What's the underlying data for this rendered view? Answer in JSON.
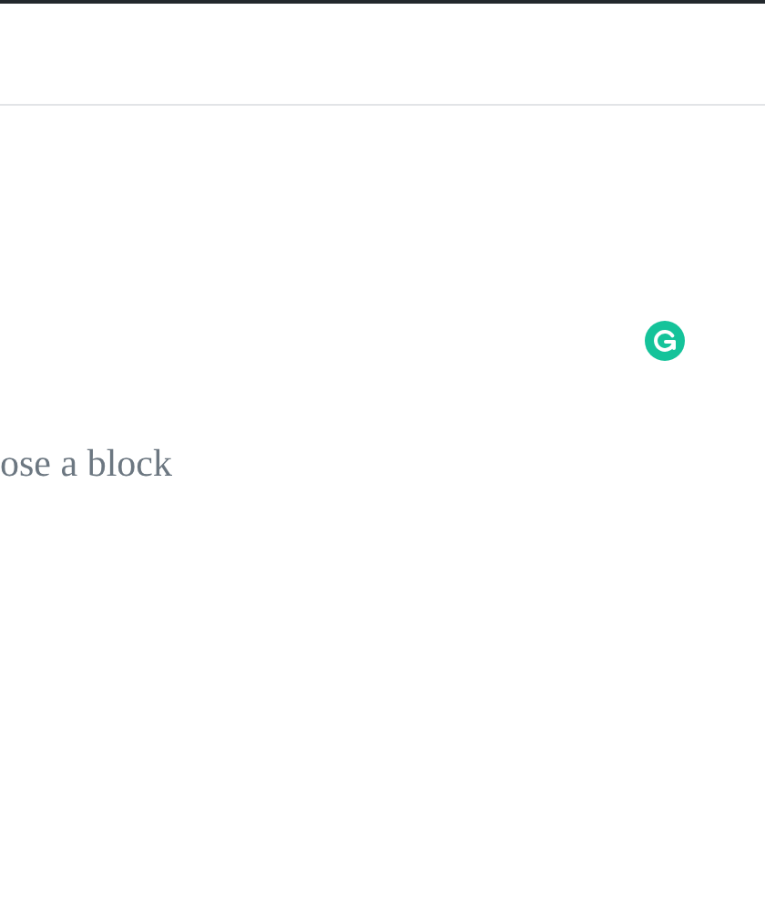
{
  "editor": {
    "prompt_text": "ose a block"
  }
}
